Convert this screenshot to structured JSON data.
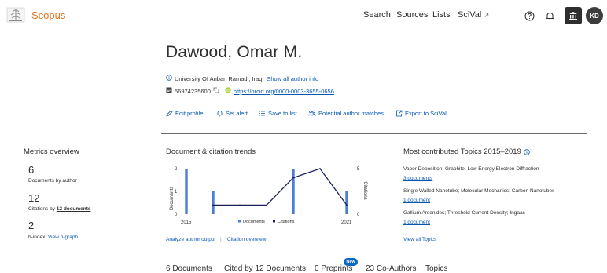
{
  "header": {
    "brand": "Scopus",
    "nav": [
      "Search",
      "Sources",
      "Lists",
      "SciVal"
    ],
    "scival_arrow": "↗",
    "help_icon": "help-icon",
    "bell_icon": "bell-icon",
    "institution_icon": "institution-icon",
    "avatar_initials": "KD",
    "brand_color": "#e9711c"
  },
  "profile": {
    "name": "Dawood, Omar M.",
    "affiliation_link": "University Of Anbar",
    "affiliation_location": ", Ramadi, Iraq",
    "show_all_info": "Show all author info",
    "scopus_id": "56974235600",
    "orcid_url": "https://orcid.org/0000-0003-3655-0656",
    "link_color": "#0656b4"
  },
  "actions": [
    "Edit profile",
    "Set alert",
    "Save to list",
    "Potential author matches",
    "Export to SciVal"
  ],
  "metrics": {
    "title": "Metrics overview",
    "documents_value": "6",
    "documents_label": "Documents by author",
    "citations_value": "12",
    "citations_label_prefix": "Citations by ",
    "citations_label_bold": "12 documents",
    "hindex_value": "2",
    "hindex_label": "h-index:",
    "hindex_link": "View h-graph"
  },
  "trends": {
    "title": "Document & citation trends",
    "left_axis_label": "Documents",
    "right_axis_label": "Citations",
    "left_ticks": [
      "2",
      "1",
      "0"
    ],
    "right_ticks": [
      "5",
      "0"
    ],
    "x_start": "2015",
    "x_end": "2021",
    "legend_documents": "Documents",
    "legend_citations": "Citations",
    "analyze_link": "Analyze author output",
    "citation_link": "Citation overview"
  },
  "chart_data": {
    "type": "bar",
    "x": [
      "2015",
      "2016",
      "2017",
      "2018",
      "2019",
      "2020",
      "2021"
    ],
    "series": [
      {
        "name": "Documents",
        "axis": "left",
        "type": "bar",
        "values": [
          2,
          1,
          0,
          0,
          2,
          0,
          1
        ],
        "color": "#4a7fd4"
      },
      {
        "name": "Citations",
        "axis": "right",
        "type": "line",
        "values": [
          null,
          1,
          1,
          1,
          4,
          5,
          1
        ],
        "color": "#1b1f5e"
      }
    ],
    "ylim_left": [
      0,
      2
    ],
    "ylim_right": [
      0,
      5
    ],
    "title": "Document & citation trends",
    "xlabel": "",
    "ylabel": "Documents",
    "y2label": "Citations"
  },
  "topics": {
    "title": "Most contributed Topics 2015–2019",
    "items": [
      {
        "name": "Vapor Deposition; Graphite; Low Energy Electron Diffraction",
        "docs": "3 documents"
      },
      {
        "name": "Single Walled Nanotube; Molecular Mechanics; Carbon Nanotubes",
        "docs": "1 document"
      },
      {
        "name": "Gallium Arsenides; Threshold Current Density; Ingaas",
        "docs": "1 document"
      }
    ],
    "view_all": "View all Topics"
  },
  "tabs": [
    "6 Documents",
    "Cited by 12 Documents",
    "0 Preprints",
    "23 Co-Authors",
    "Topics"
  ],
  "new_badge": "New"
}
